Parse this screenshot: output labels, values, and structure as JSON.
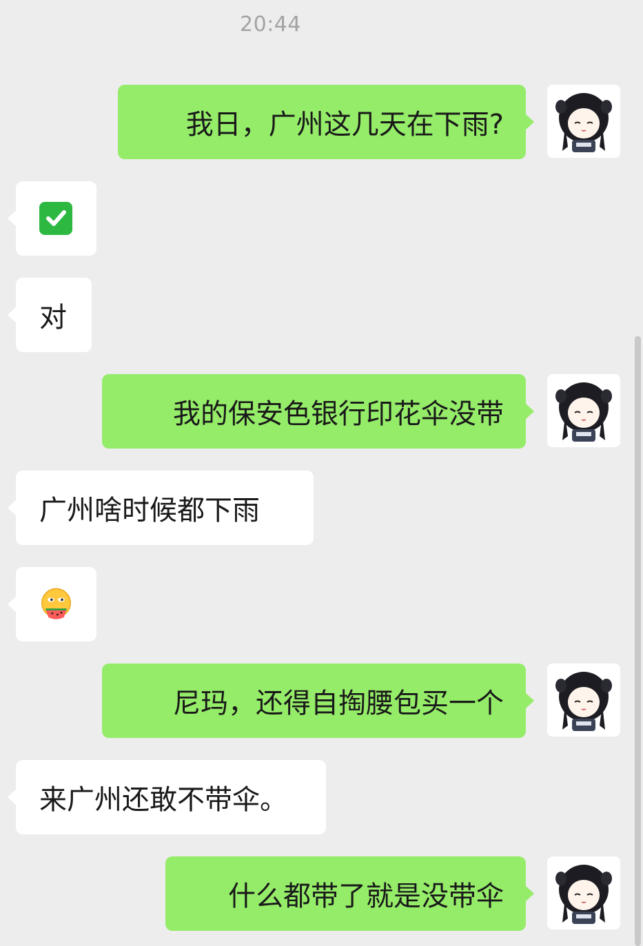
{
  "chat": {
    "timestamp": "20:44",
    "messages": [
      {
        "side": "out",
        "text": "我日，广州这几天在下雨?"
      },
      {
        "side": "in",
        "emoji": "check-mark-button"
      },
      {
        "side": "in",
        "text": "对"
      },
      {
        "side": "out",
        "text": "我的保安色银行印花伞没带"
      },
      {
        "side": "in",
        "text": "广州啥时候都下雨"
      },
      {
        "side": "in",
        "emoji": "eating-watermelon-face"
      },
      {
        "side": "out",
        "text": "尼玛，还得自掏腰包买一个"
      },
      {
        "side": "in",
        "text": "来广州还敢不带伞。"
      },
      {
        "side": "out",
        "text": "什么都带了就是没带伞"
      }
    ]
  },
  "colors": {
    "background": "#ededed",
    "outgoing_bubble": "#95ec69",
    "incoming_bubble": "#ffffff"
  }
}
